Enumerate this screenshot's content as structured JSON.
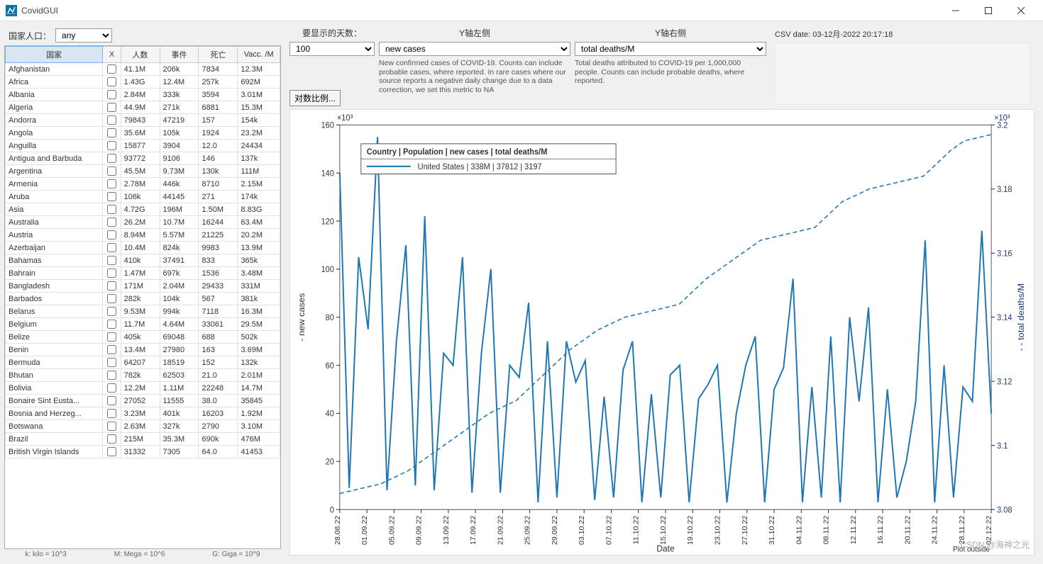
{
  "window": {
    "title": "CovidGUI"
  },
  "leftPanel": {
    "popLabel": "国家人口：",
    "popValue": "any",
    "headers": {
      "country": "国家",
      "x": "X",
      "pop": "人数",
      "events": "事件",
      "deaths": "死亡",
      "vacc": "Vacc. /M"
    },
    "rows": [
      {
        "c": "Afghanistan",
        "p": "41.1M",
        "e": "206k",
        "d": "7834",
        "v": "12.3M"
      },
      {
        "c": "Africa",
        "p": "1.43G",
        "e": "12.4M",
        "d": "257k",
        "v": "692M"
      },
      {
        "c": "Albania",
        "p": "2.84M",
        "e": "333k",
        "d": "3594",
        "v": "3.01M"
      },
      {
        "c": "Algeria",
        "p": "44.9M",
        "e": "271k",
        "d": "6881",
        "v": "15.3M"
      },
      {
        "c": "Andorra",
        "p": "79843",
        "e": "47219",
        "d": "157",
        "v": "154k"
      },
      {
        "c": "Angola",
        "p": "35.6M",
        "e": "105k",
        "d": "1924",
        "v": "23.2M"
      },
      {
        "c": "Anguilla",
        "p": "15877",
        "e": "3904",
        "d": "12.0",
        "v": "24434"
      },
      {
        "c": "Antigua and Barbuda",
        "p": "93772",
        "e": "9106",
        "d": "146",
        "v": "137k"
      },
      {
        "c": "Argentina",
        "p": "45.5M",
        "e": "9.73M",
        "d": "130k",
        "v": "111M"
      },
      {
        "c": "Armenia",
        "p": "2.78M",
        "e": "446k",
        "d": "8710",
        "v": "2.15M"
      },
      {
        "c": "Aruba",
        "p": "106k",
        "e": "44145",
        "d": "271",
        "v": "174k"
      },
      {
        "c": "Asia",
        "p": "4.72G",
        "e": "196M",
        "d": "1.50M",
        "v": "8.83G"
      },
      {
        "c": "Australia",
        "p": "26.2M",
        "e": "10.7M",
        "d": "16244",
        "v": "63.4M"
      },
      {
        "c": "Austria",
        "p": "8.94M",
        "e": "5.57M",
        "d": "21225",
        "v": "20.2M"
      },
      {
        "c": "Azerbaijan",
        "p": "10.4M",
        "e": "824k",
        "d": "9983",
        "v": "13.9M"
      },
      {
        "c": "Bahamas",
        "p": "410k",
        "e": "37491",
        "d": "833",
        "v": "365k"
      },
      {
        "c": "Bahrain",
        "p": "1.47M",
        "e": "697k",
        "d": "1536",
        "v": "3.48M"
      },
      {
        "c": "Bangladesh",
        "p": "171M",
        "e": "2.04M",
        "d": "29433",
        "v": "331M"
      },
      {
        "c": "Barbados",
        "p": "282k",
        "e": "104k",
        "d": "567",
        "v": "381k"
      },
      {
        "c": "Belarus",
        "p": "9.53M",
        "e": "994k",
        "d": "7118",
        "v": "16.3M"
      },
      {
        "c": "Belgium",
        "p": "11.7M",
        "e": "4.64M",
        "d": "33061",
        "v": "29.5M"
      },
      {
        "c": "Belize",
        "p": "405k",
        "e": "69048",
        "d": "688",
        "v": "502k"
      },
      {
        "c": "Benin",
        "p": "13.4M",
        "e": "27980",
        "d": "163",
        "v": "3.69M"
      },
      {
        "c": "Bermuda",
        "p": "64207",
        "e": "18519",
        "d": "152",
        "v": "132k"
      },
      {
        "c": "Bhutan",
        "p": "782k",
        "e": "62503",
        "d": "21.0",
        "v": "2.01M"
      },
      {
        "c": "Bolivia",
        "p": "12.2M",
        "e": "1.11M",
        "d": "22248",
        "v": "14.7M"
      },
      {
        "c": "Bonaire Sint Eusta...",
        "p": "27052",
        "e": "11555",
        "d": "38.0",
        "v": "35845"
      },
      {
        "c": "Bosnia and Herzeg...",
        "p": "3.23M",
        "e": "401k",
        "d": "16203",
        "v": "1.92M"
      },
      {
        "c": "Botswana",
        "p": "2.63M",
        "e": "327k",
        "d": "2790",
        "v": "3.10M"
      },
      {
        "c": "Brazil",
        "p": "215M",
        "e": "35.3M",
        "d": "690k",
        "v": "476M"
      },
      {
        "c": "British Virgin Islands",
        "p": "31332",
        "e": "7305",
        "d": "64.0",
        "v": "41453"
      }
    ],
    "footerNote": {
      "k": "k: kilo = 10^3",
      "m": "M: Mega = 10^6",
      "g": "G: Giga = 10^9"
    }
  },
  "rightTop": {
    "daysLabel": "要显示的天数：",
    "daysValue": "100",
    "leftAxisLabel": "Y轴左侧",
    "leftAxisValue": "new cases",
    "leftAxisDesc": "New confirmed cases of COVID-19. Counts can include probable cases, where reported. In rare cases where our source reports a negative daily change due to a data correction, we set this metric to NA",
    "rightAxisLabel": "Y轴右侧",
    "rightAxisValue": "total deaths/M",
    "rightAxisDesc": "Total deaths attributed to COVID-19 per 1,000,000 people. Counts can include probable deaths, where reported.",
    "csvDate": "CSV date: 03-12月-2022 20:17:18",
    "logBtn": "对数比例..."
  },
  "chart": {
    "yLeftLabel": "- new cases",
    "yRightLabel": "- - total deaths/M",
    "xLabel": "Date",
    "yLeftMult": "×10³",
    "yRightMult": "×10³",
    "legendHeader": "Country  | Population | new cases | total deaths/M",
    "legendRow": "United States | 338M | 37812 | 3197",
    "plotOutside": "Plot outside",
    "watermark": "CSDN @海神之光"
  },
  "chart_data": {
    "type": "line",
    "xlabel": "Date",
    "x": [
      "28.08.22",
      "01.09.22",
      "05.09.22",
      "09.09.22",
      "13.09.22",
      "17.09.22",
      "21.09.22",
      "25.09.22",
      "29.09.22",
      "03.10.22",
      "07.10.22",
      "11.10.22",
      "15.10.22",
      "19.10.22",
      "23.10.22",
      "27.10.22",
      "31.10.22",
      "04.11.22",
      "08.11.22",
      "12.11.22",
      "16.11.22",
      "20.11.22",
      "24.11.22",
      "28.11.22",
      "02.12.22"
    ],
    "series": [
      {
        "name": "new cases (×10^3)",
        "axis": "left",
        "style": "solid",
        "ylim": [
          0,
          160
        ],
        "values": [
          140,
          9,
          105,
          75,
          155,
          8,
          70,
          110,
          10,
          122,
          8,
          65,
          60,
          105,
          7,
          65,
          100,
          7,
          60,
          55,
          86,
          3,
          70,
          5,
          70,
          53,
          62,
          4,
          47,
          5,
          58,
          70,
          3,
          48,
          5,
          56,
          60,
          3,
          46,
          52,
          60,
          3,
          40,
          60,
          72,
          3,
          50,
          59,
          96,
          3,
          51,
          5,
          72,
          3,
          80,
          45,
          84,
          3,
          50,
          5,
          20,
          45,
          112,
          3,
          60,
          5,
          51,
          45,
          116,
          40
        ]
      },
      {
        "name": "total deaths/M (×10^3)",
        "axis": "right",
        "style": "dashed",
        "ylim": [
          3.08,
          3.2
        ],
        "values": [
          3.085,
          3.086,
          3.087,
          3.088,
          3.09,
          3.092,
          3.095,
          3.098,
          3.101,
          3.104,
          3.107,
          3.11,
          3.112,
          3.114,
          3.118,
          3.122,
          3.126,
          3.13,
          3.133,
          3.136,
          3.138,
          3.14,
          3.141,
          3.142,
          3.143,
          3.144,
          3.148,
          3.152,
          3.155,
          3.158,
          3.161,
          3.164,
          3.165,
          3.166,
          3.167,
          3.168,
          3.172,
          3.176,
          3.178,
          3.18,
          3.181,
          3.182,
          3.183,
          3.184,
          3.188,
          3.192,
          3.195,
          3.196,
          3.197
        ]
      }
    ]
  }
}
